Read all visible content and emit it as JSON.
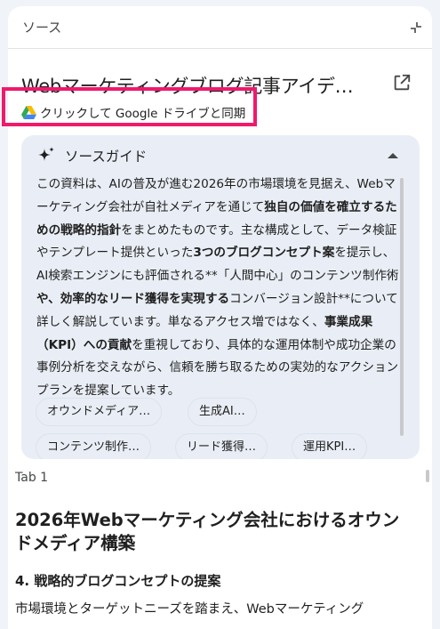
{
  "header": {
    "title": "ソース",
    "collapse_icon": "collapse-icon"
  },
  "document": {
    "title": "Webマーケティングブログ記事アイデ…",
    "open_icon": "open-in-new-icon",
    "sync_label": "クリックして Google ドライブと同期"
  },
  "guide": {
    "title": "ソースガイド",
    "summary": [
      {
        "t": "この資料は、AIの普及が進む2026年の市場環境を見据え、Webマーケティング会社が自社メディアを通じて",
        "b": false
      },
      {
        "t": "独自の価値を確立するための戦略的指針",
        "b": true
      },
      {
        "t": "をまとめたものです。主な構成として、データ検証やテンプレート提供といった",
        "b": false
      },
      {
        "t": "3つのブログコンセプト案",
        "b": true
      },
      {
        "t": "を提示し、AI検索エンジンにも評価される**「人間中心」のコンテンツ制作術",
        "b": false
      },
      {
        "t": "や、効率的なリード獲得を実現する",
        "b": true
      },
      {
        "t": "コンバージョン設計**について詳しく解説しています。単なるアクセス増ではなく、",
        "b": false
      },
      {
        "t": "事業成果（KPI）への貢献",
        "b": true
      },
      {
        "t": "を重視しており、具体的な運用体制や成功企業の事例分析を交えながら、信頼を勝ち取るための実効的なアクションプランを提案しています。",
        "b": false
      }
    ],
    "chips": [
      "オウンドメディア…",
      "生成AI…",
      "コンテンツ制作…",
      "リード獲得…",
      "運用KPI…"
    ]
  },
  "content": {
    "tab_label": "Tab 1",
    "heading": "2026年Webマーケティング会社におけるオウンドメディア構築",
    "subheading": "4. 戦略的ブログコンセプトの提案",
    "paragraph": "市場環境とターゲットニーズを踏まえ、Webマーケティング"
  }
}
